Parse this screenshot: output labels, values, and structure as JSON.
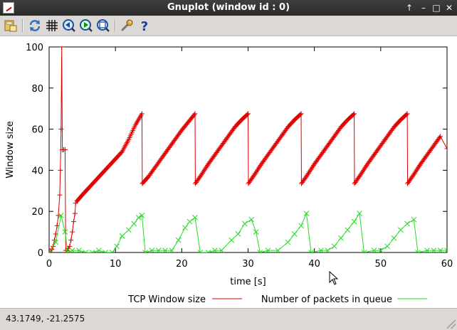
{
  "window": {
    "title": "Gnuplot (window id : 0)"
  },
  "titlebar_buttons": [
    {
      "name": "keep-above",
      "glyph": "↑"
    },
    {
      "name": "minimize",
      "glyph": "–"
    },
    {
      "name": "maximize",
      "glyph": "□"
    },
    {
      "name": "close",
      "glyph": "✕"
    }
  ],
  "toolbar": {
    "items": [
      {
        "name": "export-icon",
        "tooltip": ""
      },
      {
        "name": "replot-icon",
        "tooltip": ""
      },
      {
        "name": "grid-icon",
        "tooltip": ""
      },
      {
        "name": "zoom-previous-icon",
        "tooltip": ""
      },
      {
        "name": "zoom-next-icon",
        "tooltip": ""
      },
      {
        "name": "autoscale-icon",
        "tooltip": ""
      },
      {
        "name": "settings-icon",
        "tooltip": ""
      },
      {
        "name": "help-icon",
        "tooltip": ""
      }
    ]
  },
  "status": {
    "coordinates": "43.1749, -21.2575"
  },
  "colors": {
    "series1": "#e00000",
    "series2": "#22dd22",
    "titlebar": "#333333"
  },
  "chart_data": {
    "type": "line",
    "title": "",
    "xlabel": "time [s]",
    "ylabel": "Window size",
    "xlim": [
      0,
      60
    ],
    "ylim": [
      0,
      100
    ],
    "xticks": [
      "0",
      "10",
      "20",
      "30",
      "40",
      "50",
      "60"
    ],
    "yticks": [
      "0",
      "20",
      "40",
      "60",
      "80",
      "100"
    ],
    "legend_position": "bottom",
    "grid": false,
    "series": [
      {
        "name": "TCP Window size",
        "marker": "plus",
        "color": "#e00000",
        "points": [
          [
            0.0,
            0.5
          ],
          [
            0.2,
            1
          ],
          [
            0.4,
            1.5
          ],
          [
            0.6,
            3
          ],
          [
            0.8,
            6
          ],
          [
            1.0,
            9
          ],
          [
            1.2,
            13
          ],
          [
            1.4,
            18
          ],
          [
            1.6,
            28
          ],
          [
            1.7,
            40
          ],
          [
            1.8,
            60
          ],
          [
            1.9,
            100
          ],
          [
            2.0,
            50
          ],
          [
            2.2,
            50
          ],
          [
            2.4,
            50
          ],
          [
            2.5,
            1
          ],
          [
            2.7,
            1
          ],
          [
            2.9,
            2
          ],
          [
            3.1,
            3
          ],
          [
            3.3,
            6
          ],
          [
            3.5,
            10
          ],
          [
            3.7,
            15
          ],
          [
            3.9,
            19
          ],
          [
            4.0,
            24
          ],
          [
            4.2,
            25
          ],
          [
            5.0,
            28
          ],
          [
            6.0,
            31.5
          ],
          [
            7.0,
            35
          ],
          [
            8.0,
            38.5
          ],
          [
            9.0,
            42
          ],
          [
            10.0,
            45.5
          ],
          [
            11.0,
            49
          ],
          [
            12.0,
            55
          ],
          [
            13.0,
            62
          ],
          [
            14.0,
            67.5
          ],
          [
            14.05,
            33.5
          ],
          [
            15.0,
            37
          ],
          [
            16.0,
            41.5
          ],
          [
            17.0,
            46
          ],
          [
            18.0,
            50.5
          ],
          [
            19.0,
            55
          ],
          [
            20.0,
            59.5
          ],
          [
            21.0,
            63.5
          ],
          [
            22.0,
            67.5
          ],
          [
            22.05,
            33.5
          ],
          [
            23.0,
            38
          ],
          [
            24.0,
            43
          ],
          [
            25.0,
            47.5
          ],
          [
            26.0,
            52
          ],
          [
            27.0,
            56.5
          ],
          [
            28.0,
            61
          ],
          [
            29.0,
            64.5
          ],
          [
            30.0,
            67.5
          ],
          [
            30.05,
            33.5
          ],
          [
            31.0,
            38
          ],
          [
            32.0,
            43
          ],
          [
            33.0,
            47.5
          ],
          [
            34.0,
            52
          ],
          [
            35.0,
            56.5
          ],
          [
            36.0,
            61
          ],
          [
            37.0,
            64.5
          ],
          [
            38.0,
            67.5
          ],
          [
            38.05,
            33.5
          ],
          [
            39.0,
            38
          ],
          [
            40.0,
            43
          ],
          [
            41.0,
            47.5
          ],
          [
            42.0,
            52
          ],
          [
            43.0,
            56.5
          ],
          [
            44.0,
            61
          ],
          [
            45.0,
            64.5
          ],
          [
            46.0,
            67.5
          ],
          [
            46.05,
            33.5
          ],
          [
            47.0,
            38
          ],
          [
            48.0,
            43
          ],
          [
            49.0,
            47.5
          ],
          [
            50.0,
            52
          ],
          [
            51.0,
            56.5
          ],
          [
            52.0,
            61
          ],
          [
            53.0,
            64.5
          ],
          [
            54.0,
            67.5
          ],
          [
            54.05,
            33.5
          ],
          [
            55.0,
            38
          ],
          [
            56.0,
            43
          ],
          [
            57.0,
            47.5
          ],
          [
            58.0,
            52
          ],
          [
            59.0,
            56.5
          ],
          [
            60.0,
            50.5
          ]
        ]
      },
      {
        "name": "Number of packets in queue",
        "marker": "cross",
        "color": "#22dd22",
        "points": [
          [
            0,
            0
          ],
          [
            1,
            5
          ],
          [
            1.8,
            18
          ],
          [
            2.4,
            10
          ],
          [
            2.8,
            0
          ],
          [
            3.5,
            1
          ],
          [
            4.5,
            1
          ],
          [
            5.5,
            0
          ],
          [
            6.5,
            0
          ],
          [
            7.5,
            1
          ],
          [
            8.5,
            0
          ],
          [
            9.5,
            0
          ],
          [
            10.2,
            3
          ],
          [
            11,
            8
          ],
          [
            12,
            11
          ],
          [
            12.8,
            14
          ],
          [
            13.5,
            17
          ],
          [
            14,
            18
          ],
          [
            14.5,
            0
          ],
          [
            15.5,
            1
          ],
          [
            16.5,
            1
          ],
          [
            17.5,
            1
          ],
          [
            18.5,
            1
          ],
          [
            19.5,
            6
          ],
          [
            20.5,
            12
          ],
          [
            21.2,
            15
          ],
          [
            22,
            17
          ],
          [
            22.8,
            0
          ],
          [
            24,
            0
          ],
          [
            25,
            1
          ],
          [
            26,
            1
          ],
          [
            27.5,
            6
          ],
          [
            28.5,
            9
          ],
          [
            29.5,
            14
          ],
          [
            30.5,
            16
          ],
          [
            31.2,
            10
          ],
          [
            31.8,
            0
          ],
          [
            33,
            1
          ],
          [
            34.5,
            1
          ],
          [
            36,
            5
          ],
          [
            37,
            9
          ],
          [
            38,
            13
          ],
          [
            38.8,
            19
          ],
          [
            39.5,
            0
          ],
          [
            41,
            1
          ],
          [
            42,
            1
          ],
          [
            43,
            3
          ],
          [
            44,
            7
          ],
          [
            45,
            11
          ],
          [
            46,
            15
          ],
          [
            46.8,
            19
          ],
          [
            47.5,
            0
          ],
          [
            49,
            1
          ],
          [
            50,
            1
          ],
          [
            51,
            3
          ],
          [
            52,
            7
          ],
          [
            53,
            11
          ],
          [
            54,
            14
          ],
          [
            55,
            16
          ],
          [
            55.6,
            0
          ],
          [
            57,
            1
          ],
          [
            58,
            1
          ],
          [
            59,
            1
          ],
          [
            60,
            1
          ]
        ]
      }
    ]
  }
}
